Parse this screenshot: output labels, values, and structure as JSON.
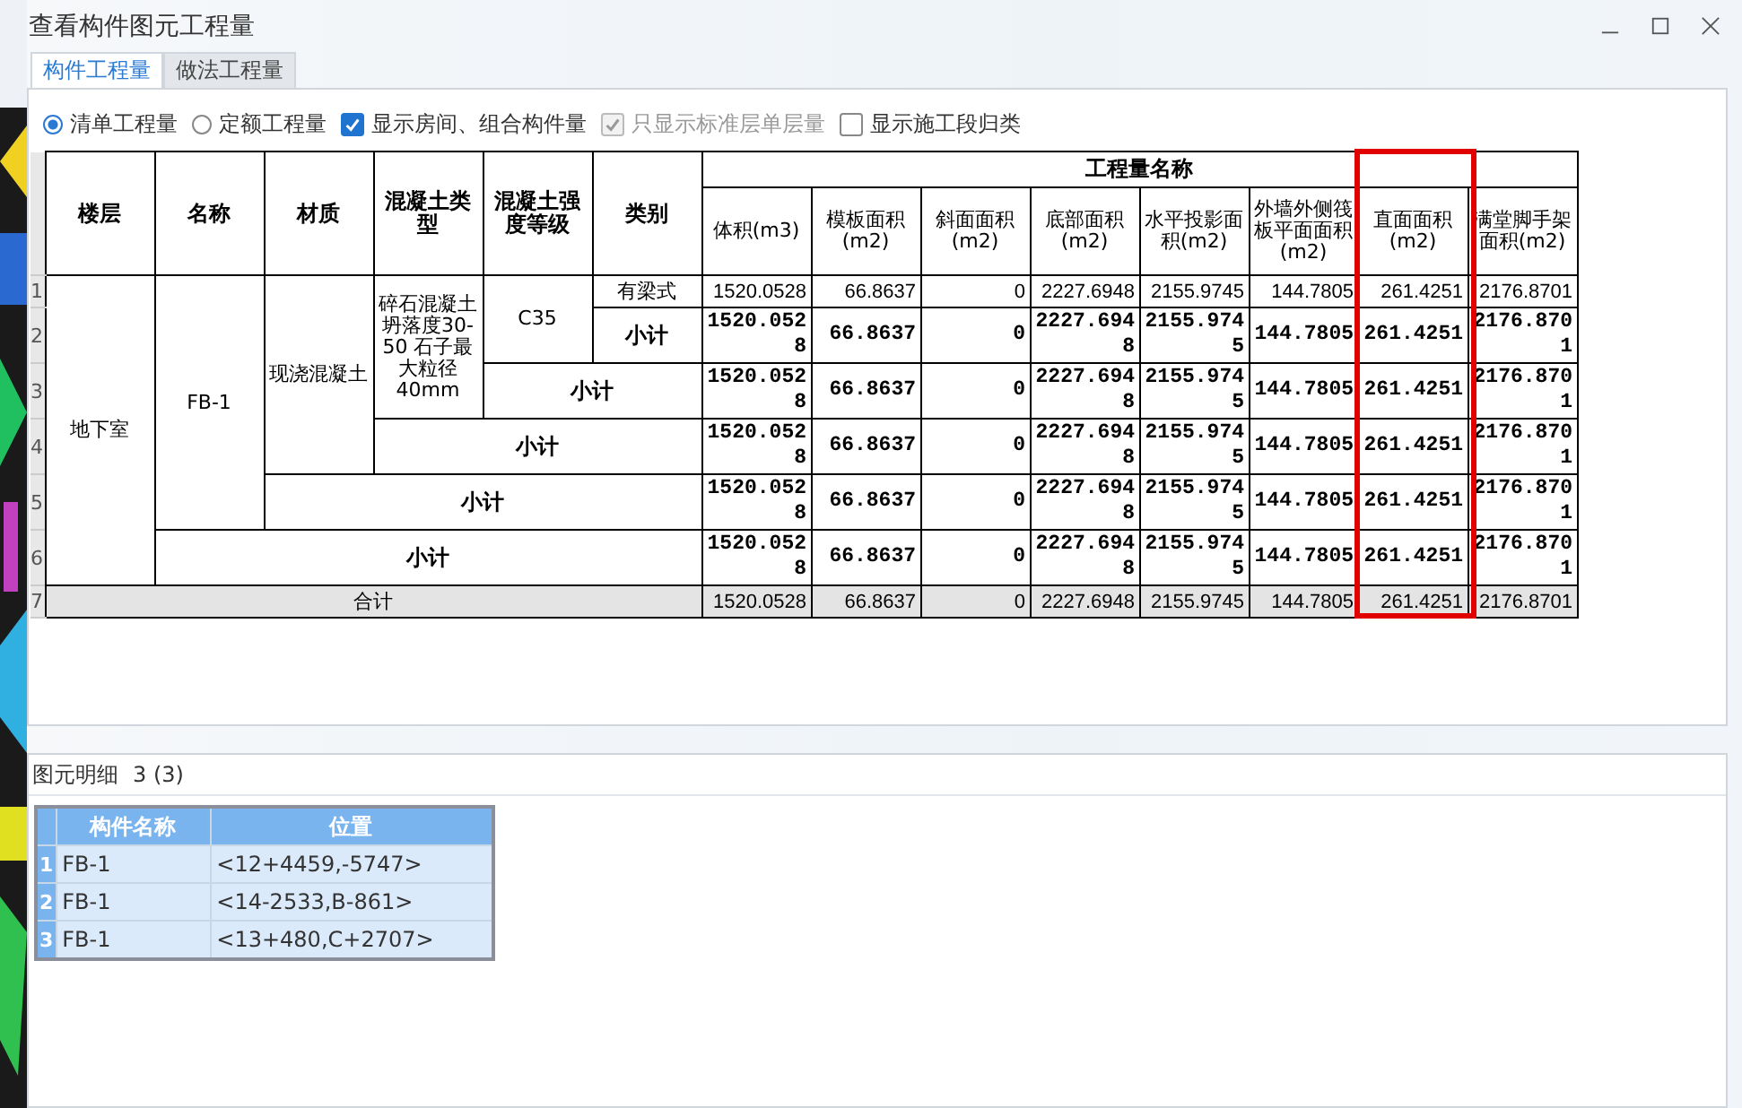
{
  "window": {
    "title": "查看构件图元工程量"
  },
  "tabs": [
    {
      "label": "构件工程量",
      "selected": true
    },
    {
      "label": "做法工程量",
      "selected": false
    }
  ],
  "options": [
    {
      "kind": "radio",
      "label": "清单工程量",
      "selected": true,
      "disabled": false
    },
    {
      "kind": "radio",
      "label": "定额工程量",
      "selected": false,
      "disabled": false
    },
    {
      "kind": "checkbox",
      "label": "显示房间、组合构件量",
      "checked": true,
      "disabled": false
    },
    {
      "kind": "checkbox",
      "label": "只显示标准层单层量",
      "checked": true,
      "disabled": true
    },
    {
      "kind": "checkbox",
      "label": "显示施工段归类",
      "checked": false,
      "disabled": false
    }
  ],
  "quantity_table": {
    "group_columns": [
      "楼层",
      "名称",
      "材质",
      "混凝土类型",
      "混凝土强度等级",
      "类别"
    ],
    "quantity_header": "工程量名称",
    "quantity_columns": [
      {
        "label": "体积(m3)",
        "highlighted": false
      },
      {
        "label": "模板面积(m2)",
        "highlighted": false
      },
      {
        "label": "斜面面积(m2)",
        "highlighted": false
      },
      {
        "label": "底部面积(m2)",
        "highlighted": false
      },
      {
        "label": "水平投影面积(m2)",
        "highlighted": false
      },
      {
        "label": "外墙外侧筏板平面面积(m2)",
        "highlighted": false
      },
      {
        "label": "直面面积(m2)",
        "highlighted": true
      },
      {
        "label": "满堂脚手架面积(m2)",
        "highlighted": false
      }
    ],
    "row_numbers": [
      "1",
      "2",
      "3",
      "4",
      "5",
      "6",
      "7"
    ],
    "floors": [
      {
        "label": "地下室",
        "children": [
          {
            "label": "FB-1",
            "children": [
              {
                "label": "现浇混凝土",
                "children": [
                  {
                    "label": "碎石混凝土坍落度30-50 石子最大粒径40mm",
                    "children": [
                      {
                        "label": "C35",
                        "children": [
                          {
                            "label": "有梁式",
                            "values": [
                              "1520.0528",
                              "66.8637",
                              "0",
                              "2227.6948",
                              "2155.9745",
                              "144.7805",
                              "261.4251",
                              "2176.8701"
                            ]
                          }
                        ],
                        "subtotal": {
                          "label": "小计",
                          "values": [
                            "1520.0528",
                            "66.8637",
                            "0",
                            "2227.6948",
                            "2155.9745",
                            "144.7805",
                            "261.4251",
                            "2176.8701"
                          ]
                        }
                      }
                    ],
                    "subtotal": {
                      "label": "小计",
                      "values": [
                        "1520.0528",
                        "66.8637",
                        "0",
                        "2227.6948",
                        "2155.9745",
                        "144.7805",
                        "261.4251",
                        "2176.8701"
                      ]
                    }
                  }
                ],
                "subtotal": {
                  "label": "小计",
                  "values": [
                    "1520.0528",
                    "66.8637",
                    "0",
                    "2227.6948",
                    "2155.9745",
                    "144.7805",
                    "261.4251",
                    "2176.8701"
                  ]
                }
              }
            ],
            "subtotal": {
              "label": "小计",
              "values": [
                "1520.0528",
                "66.8637",
                "0",
                "2227.6948",
                "2155.9745",
                "144.7805",
                "261.4251",
                "2176.8701"
              ]
            }
          }
        ],
        "subtotal": {
          "label": "小计",
          "values": [
            "1520.0528",
            "66.8637",
            "0",
            "2227.6948",
            "2155.9745",
            "144.7805",
            "261.4251",
            "2176.8701"
          ]
        }
      }
    ],
    "total": {
      "label": "合计",
      "values": [
        "1520.0528",
        "66.8637",
        "0",
        "2227.6948",
        "2155.9745",
        "144.7805",
        "261.4251",
        "2176.8701"
      ]
    }
  },
  "detail": {
    "title": "图元明细",
    "count": "3 (3)",
    "columns": [
      "构件名称",
      "位置"
    ],
    "rows": [
      {
        "row_number": "1",
        "cells": [
          "FB-1",
          "<12+4459,-5747>"
        ],
        "selected": true
      },
      {
        "row_number": "2",
        "cells": [
          "FB-1",
          "<14-2533,B-861>"
        ],
        "selected": true
      },
      {
        "row_number": "3",
        "cells": [
          "FB-1",
          "<13+480,C+2707>"
        ],
        "selected": true
      }
    ]
  }
}
